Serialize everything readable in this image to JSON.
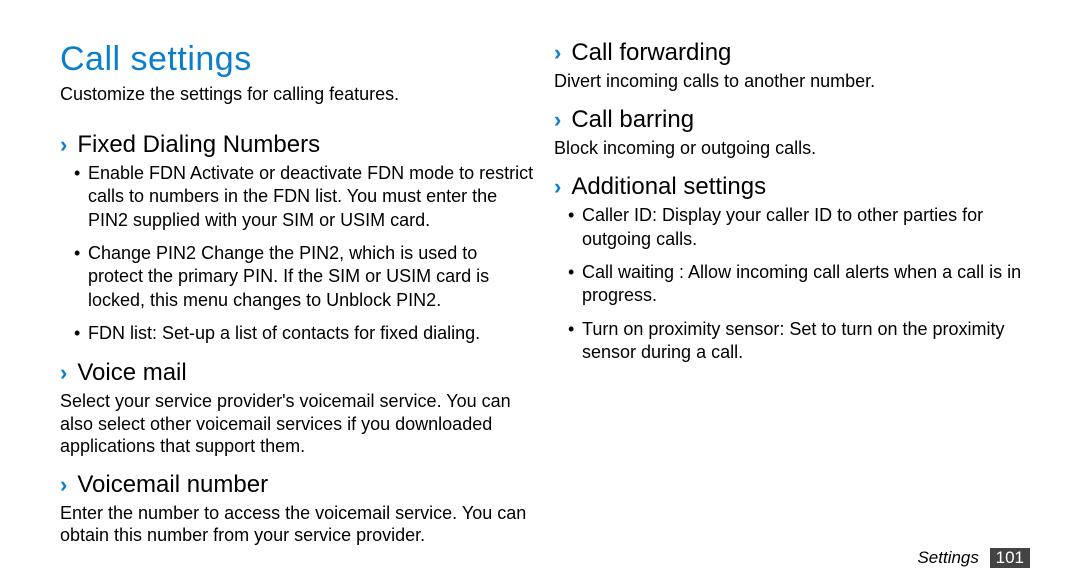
{
  "title": "Call settings",
  "intro": "Customize the settings for calling features.",
  "sections": {
    "fdn": {
      "heading": "Fixed Dialing Numbers",
      "bullets": [
        "Enable FDN Activate or deactivate FDN mode to restrict calls to numbers in the FDN list. You must enter the PIN2 supplied with your SIM or USIM card.",
        "Change PIN2 Change the PIN2, which is used to protect the primary PIN. If the SIM or USIM card is locked, this menu changes to Unblock PIN2.",
        "FDN list: Set-up a list of contacts for ﬁxed dialing."
      ]
    },
    "voicemail": {
      "heading": "Voice mail",
      "body": "Select your service provider's voicemail service. You can also select other voicemail services if you downloaded applications that support them."
    },
    "voicemail_number": {
      "heading": "Voicemail number",
      "body": "Enter the number to access the voicemail service. You can obtain this number from your service provider."
    },
    "call_forwarding": {
      "heading": "Call forwarding",
      "body": "Divert incoming calls to another number."
    },
    "call_barring": {
      "heading": "Call barring",
      "body": "Block incoming or outgoing calls."
    },
    "additional": {
      "heading": "Additional settings",
      "bullets": [
        "Caller ID: Display your caller ID to other parties for outgoing calls.",
        "Call waiting : Allow incoming call alerts when a call is in progress.",
        "Turn on proximity sensor: Set to turn on the proximity sensor during a call."
      ]
    }
  },
  "footer": {
    "label": "Settings",
    "page": "101"
  },
  "chevron": "›"
}
